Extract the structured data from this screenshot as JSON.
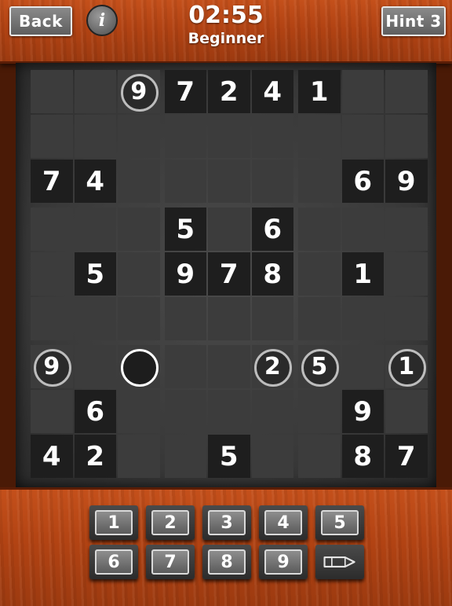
{
  "header": {
    "back_label": "Back",
    "info_glyph": "i",
    "timer": "02:55",
    "level": "Beginner",
    "hint_label": "Hint 3"
  },
  "board": {
    "size": 9,
    "cells": [
      [
        "",
        "",
        "9",
        "7",
        "2",
        "4",
        "1",
        "",
        ""
      ],
      [
        "",
        "",
        "",
        "",
        "",
        "",
        "",
        "",
        ""
      ],
      [
        "7",
        "4",
        "",
        "",
        "",
        "",
        "",
        "6",
        "9"
      ],
      [
        "",
        "",
        "",
        "5",
        "",
        "6",
        "",
        "",
        ""
      ],
      [
        "",
        "5",
        "",
        "9",
        "7",
        "8",
        "",
        "1",
        ""
      ],
      [
        "",
        "",
        "",
        "",
        "",
        "",
        "",
        "",
        ""
      ],
      [
        "9",
        "",
        "",
        "",
        "",
        "2",
        "5",
        "",
        "1"
      ],
      [
        "",
        "6",
        "",
        "",
        "",
        "",
        "",
        "9",
        ""
      ],
      [
        "4",
        "2",
        "",
        "",
        "5",
        "",
        "",
        "8",
        "7"
      ]
    ],
    "circled": [
      [
        0,
        2
      ],
      [
        6,
        0
      ],
      [
        6,
        2
      ],
      [
        6,
        5
      ],
      [
        6,
        6
      ],
      [
        6,
        8
      ]
    ],
    "selected": [
      6,
      2
    ],
    "colors": {
      "background": "#3c3c3c",
      "given": "#1e1e1e",
      "digit": "#ffffff",
      "ring": "#bdbdbd"
    }
  },
  "keypad": {
    "keys": [
      "1",
      "2",
      "3",
      "4",
      "5",
      "6",
      "7",
      "8",
      "9"
    ],
    "pencil_icon": "pencil-icon"
  },
  "colors": {
    "wood": "#b24313",
    "button": "#6e6e6e"
  }
}
